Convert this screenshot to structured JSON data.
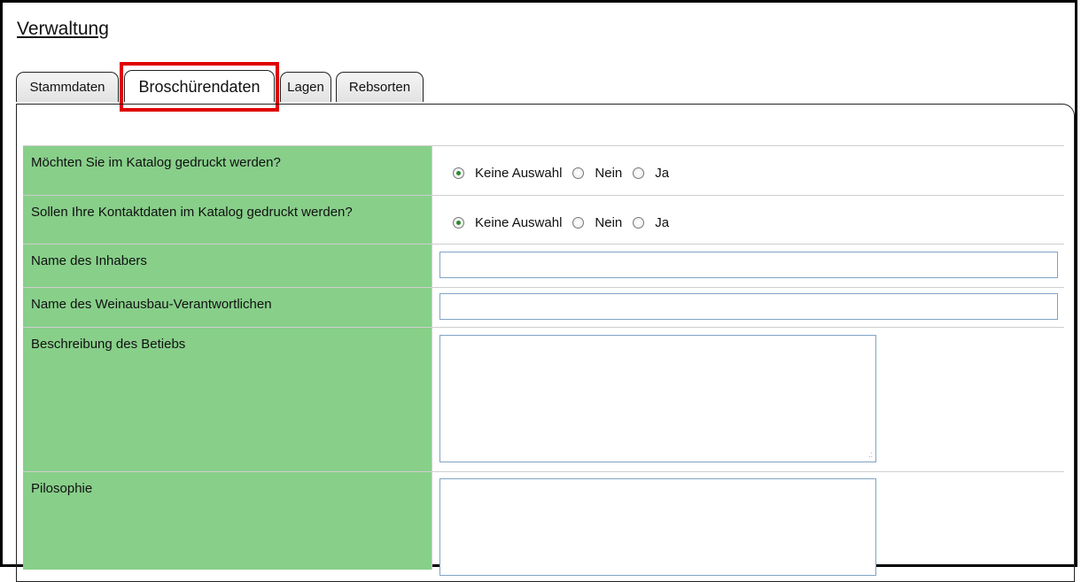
{
  "page": {
    "title": "Verwaltung"
  },
  "tabs": [
    {
      "label": "Stammdaten"
    },
    {
      "label": "Broschürendaten"
    },
    {
      "label": "Lagen"
    },
    {
      "label": "Rebsorten"
    }
  ],
  "form": {
    "rows": [
      {
        "label": "Möchten Sie im Katalog gedruckt werden?",
        "options": [
          "Keine Auswahl",
          "Nein",
          "Ja"
        ],
        "selected": "Keine Auswahl"
      },
      {
        "label": "Sollen Ihre Kontaktdaten im Katalog gedruckt werden?",
        "options": [
          "Keine Auswahl",
          "Nein",
          "Ja"
        ],
        "selected": "Keine Auswahl"
      },
      {
        "label": "Name des Inhabers",
        "value": ""
      },
      {
        "label": "Name des Weinausbau-Verantwortlichen",
        "value": ""
      },
      {
        "label": "Beschreibung des Betiebs",
        "value": ""
      },
      {
        "label": "Pilosophie",
        "value": ""
      }
    ]
  },
  "colors": {
    "label_bg": "#88cf8a",
    "highlight": "#e00000",
    "input_border": "#7fa4c4"
  }
}
